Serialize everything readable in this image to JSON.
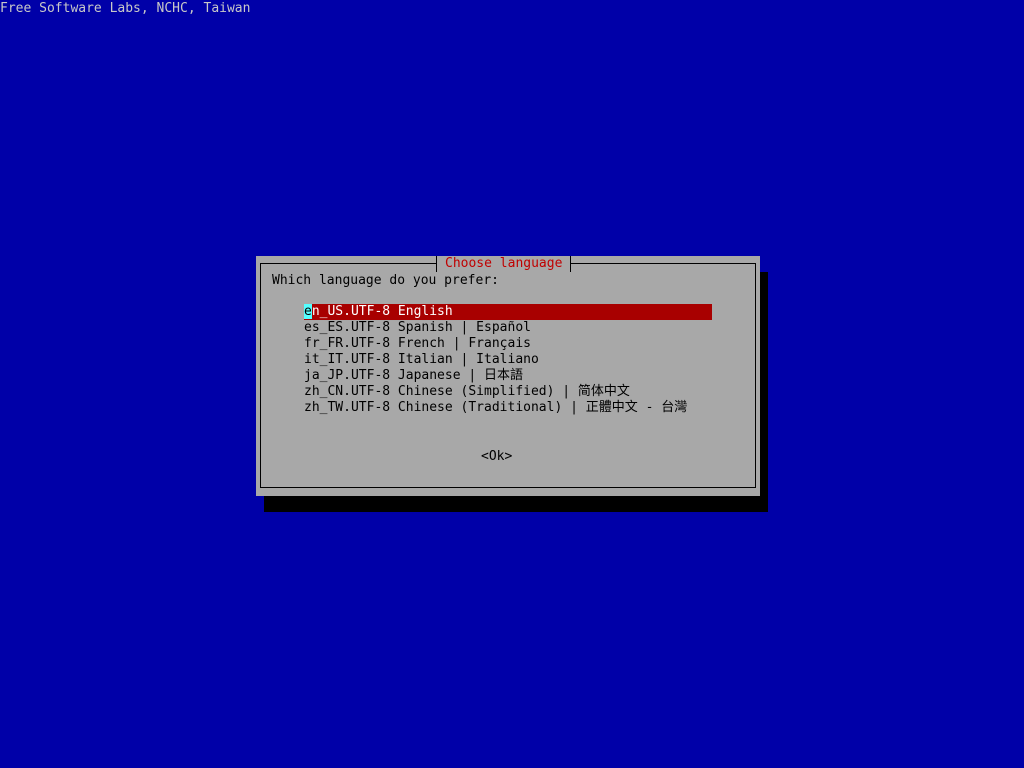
{
  "backtitle": "Free Software Labs, NCHC, Taiwan",
  "dialog": {
    "title": "Choose language",
    "prompt": "Which language do you prefer:",
    "selected_index": 0,
    "items": [
      {
        "cursor_char": "e",
        "rest": "n_US.UTF-8 English",
        "label": "en_US.UTF-8 English"
      },
      {
        "label": "es_ES.UTF-8 Spanish | Español"
      },
      {
        "label": "fr_FR.UTF-8 French | Français"
      },
      {
        "label": "it_IT.UTF-8 Italian | Italiano"
      },
      {
        "label": "ja_JP.UTF-8 Japanese | 日本語"
      },
      {
        "label": "zh_CN.UTF-8 Chinese (Simplified) | 简体中文"
      },
      {
        "label": "zh_TW.UTF-8 Chinese (Traditional) | 正體中文 - 台灣"
      }
    ],
    "ok_label": "<Ok>"
  },
  "colors": {
    "background": "#0000a8",
    "dialog_bg": "#a8a8a8",
    "title": "#c00000",
    "highlight": "#a80000",
    "cursor": "#55ffff"
  }
}
